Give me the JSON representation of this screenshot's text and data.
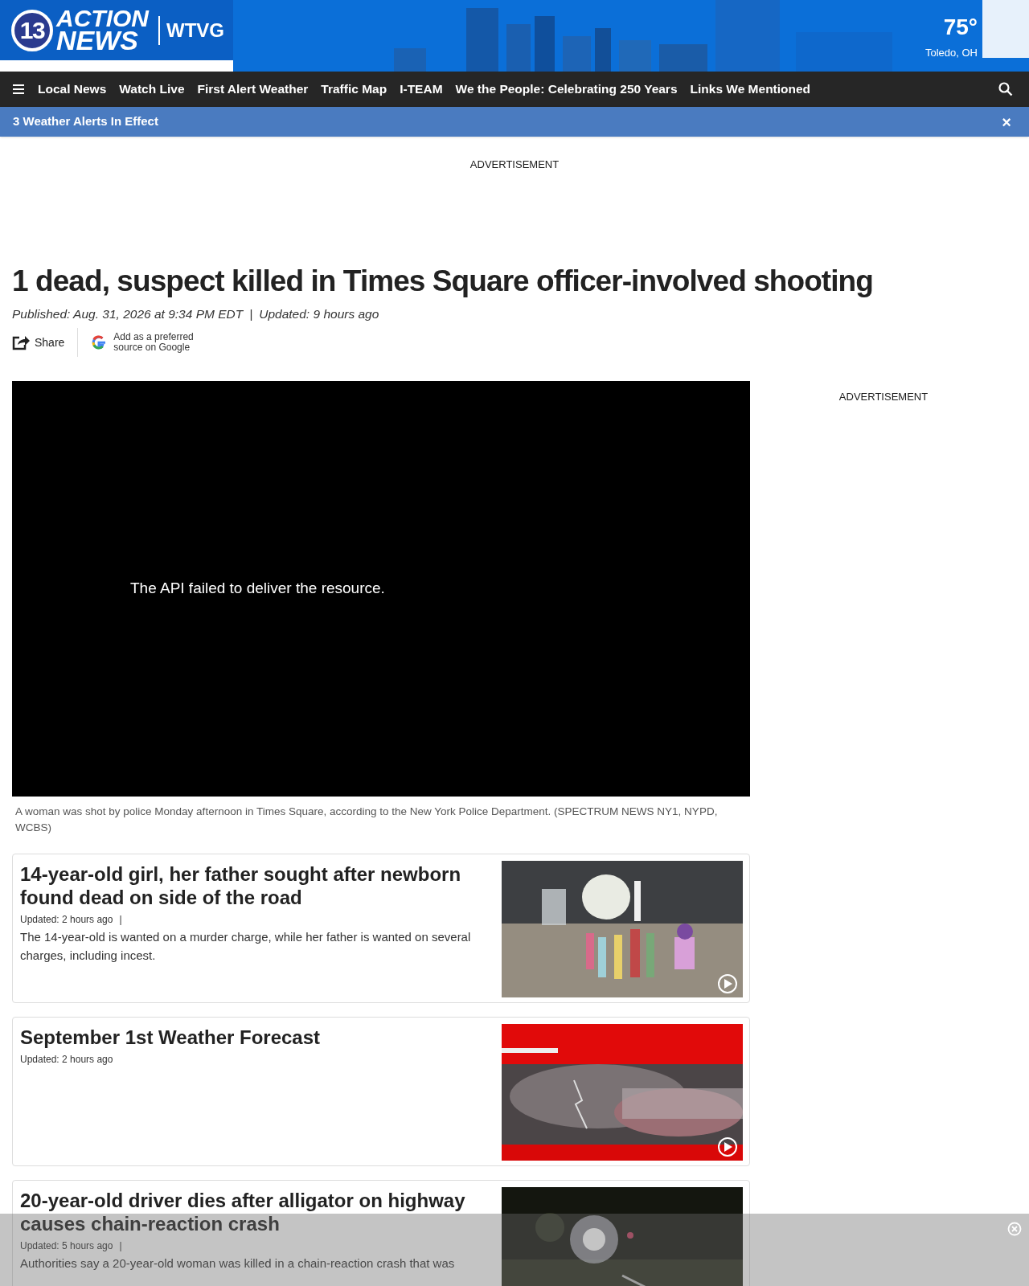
{
  "header": {
    "logo_number": "13",
    "logo_line1": "ACTION",
    "logo_line2": "NEWS",
    "station": "WTVG",
    "temperature": "75°",
    "location": "Toledo, OH"
  },
  "nav": {
    "items": [
      "Local News",
      "Watch Live",
      "First Alert Weather",
      "Traffic Map",
      "I-TEAM",
      "We the People: Celebrating 250 Years",
      "Links We Mentioned"
    ]
  },
  "alert_bar": {
    "text": "3 Weather Alerts In Effect",
    "close": "×"
  },
  "top_ad": "ADVERTISEMENT",
  "article": {
    "headline": "1 dead, suspect killed in Times Square officer-involved shooting",
    "published": "Published: Aug. 31, 2026 at 9:34 PM EDT",
    "separator": "|",
    "updated": "Updated: 9 hours ago",
    "share": "Share",
    "google": "Add as a preferred source on Google",
    "video": {
      "message": "The API failed to deliver the resource."
    },
    "caption": "A woman was shot by police Monday afternoon in Times Square, according to the New York Police Department. (SPECTRUM NEWS NY1, NYPD, WCBS)"
  },
  "side_ad": "ADVERTISEMENT",
  "stories": [
    {
      "title": "14-year-old girl, her father sought after newborn found dead on side of the road",
      "updated": "Updated: 2 hours ago",
      "separator": "|",
      "summary": "The 14-year-old is wanted on a murder charge, while her father is wanted on several charges, including incest.",
      "kind": "memorial"
    },
    {
      "title": "September 1st Weather Forecast",
      "updated": "Updated: 2 hours ago",
      "kind": "weather"
    },
    {
      "title": "20-year-old driver dies after alligator on highway causes chain-reaction crash",
      "updated": "Updated: 5 hours ago",
      "separator": "|",
      "summary": "Authorities say a 20-year-old woman was killed in a chain-reaction crash that was",
      "kind": "night"
    }
  ]
}
